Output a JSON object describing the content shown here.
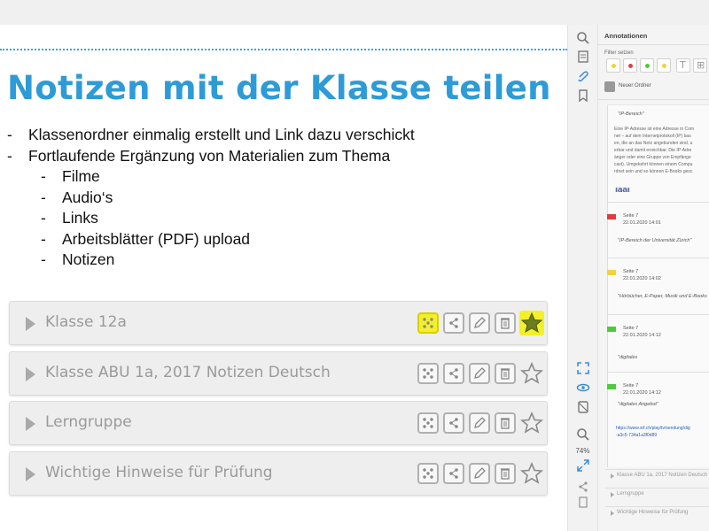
{
  "slide": {
    "title": "Notizen mit der Klasse teilen",
    "bullets": [
      "Klassenordner einmalig erstellt und Link dazu verschickt",
      "Fortlaufende Ergänzung von Materialien zum Thema"
    ],
    "sub_bullets": [
      "Filme",
      "Audio‘s",
      "Links",
      "Arbeitsblätter (PDF) upload",
      "Notizen"
    ],
    "dash": "-"
  },
  "folders": [
    {
      "name": "Klasse 12a",
      "highlighted": true,
      "starred": true
    },
    {
      "name": "Klasse ABU 1a, 2017 Notizen Deutsch",
      "highlighted": false,
      "starred": false
    },
    {
      "name": "Lerngruppe",
      "highlighted": false,
      "starred": false
    },
    {
      "name": "Wichtige Hinweise für Prüfung",
      "highlighted": false,
      "starred": false
    }
  ],
  "toolbar": {
    "zoom": "74%",
    "icons": [
      "search-icon",
      "document-icon",
      "paperclip-icon",
      "bookmark-icon",
      "fullscreen-icon",
      "eye-icon",
      "tablet-icon",
      "zoom-icon",
      "expand-icon",
      "share-icon",
      "page-icon"
    ]
  },
  "panel": {
    "title": "Annotationen",
    "filter_label": "Filter setzen",
    "filter_colors": [
      "#f2d33a",
      "#e04040",
      "#4ccc3c",
      "#f2d33a"
    ],
    "new_folder": "Neuer Ordner",
    "first_quote": "\"IP-Bereich\"",
    "paragraph": [
      "Eine IP-Adresse ist eine Adresse in Com",
      "net – auf dem Internetprotokoll (IP) bas",
      "en, die an das Netz angebunden sind, u",
      "erbar und damit erreichbar. Die IP-Adre",
      "änger oder eine Gruppe von Empfänge",
      "cast). Umgekehrt können einem Compu",
      "rdnet sein und so können E-Books gesc"
    ],
    "logo_text": "ıaaı",
    "annotations": [
      {
        "color": "#e03c3c",
        "page": "Seite 7",
        "date": "22.01.2020 14:01",
        "quote": "\"IP-Bereich der Universität Zürich\""
      },
      {
        "color": "#f2d33a",
        "page": "Seite 7",
        "date": "22.01.2020 14:02",
        "quote": "\"Hörbücher, E-Paper, Musik und E-Books"
      },
      {
        "color": "#4ccc3c",
        "page": "Seite 7",
        "date": "22.01.2020 14:12",
        "quote": "\"digitales"
      },
      {
        "color": "#4ccc3c",
        "page": "Seite 7",
        "date": "22.01.2020 14:12",
        "quote": "\"digitales Angebot\""
      }
    ],
    "link_lines": [
      "https://www.srf.ch/play/tv/sendung/dig",
      "-a3c5-734a1a3f0d89"
    ],
    "folders": [
      "Klasse ABU 1a, 2017 Notizen Deutsch",
      "Lerngruppe",
      "Wichtige Hinweise für Prüfung"
    ]
  }
}
